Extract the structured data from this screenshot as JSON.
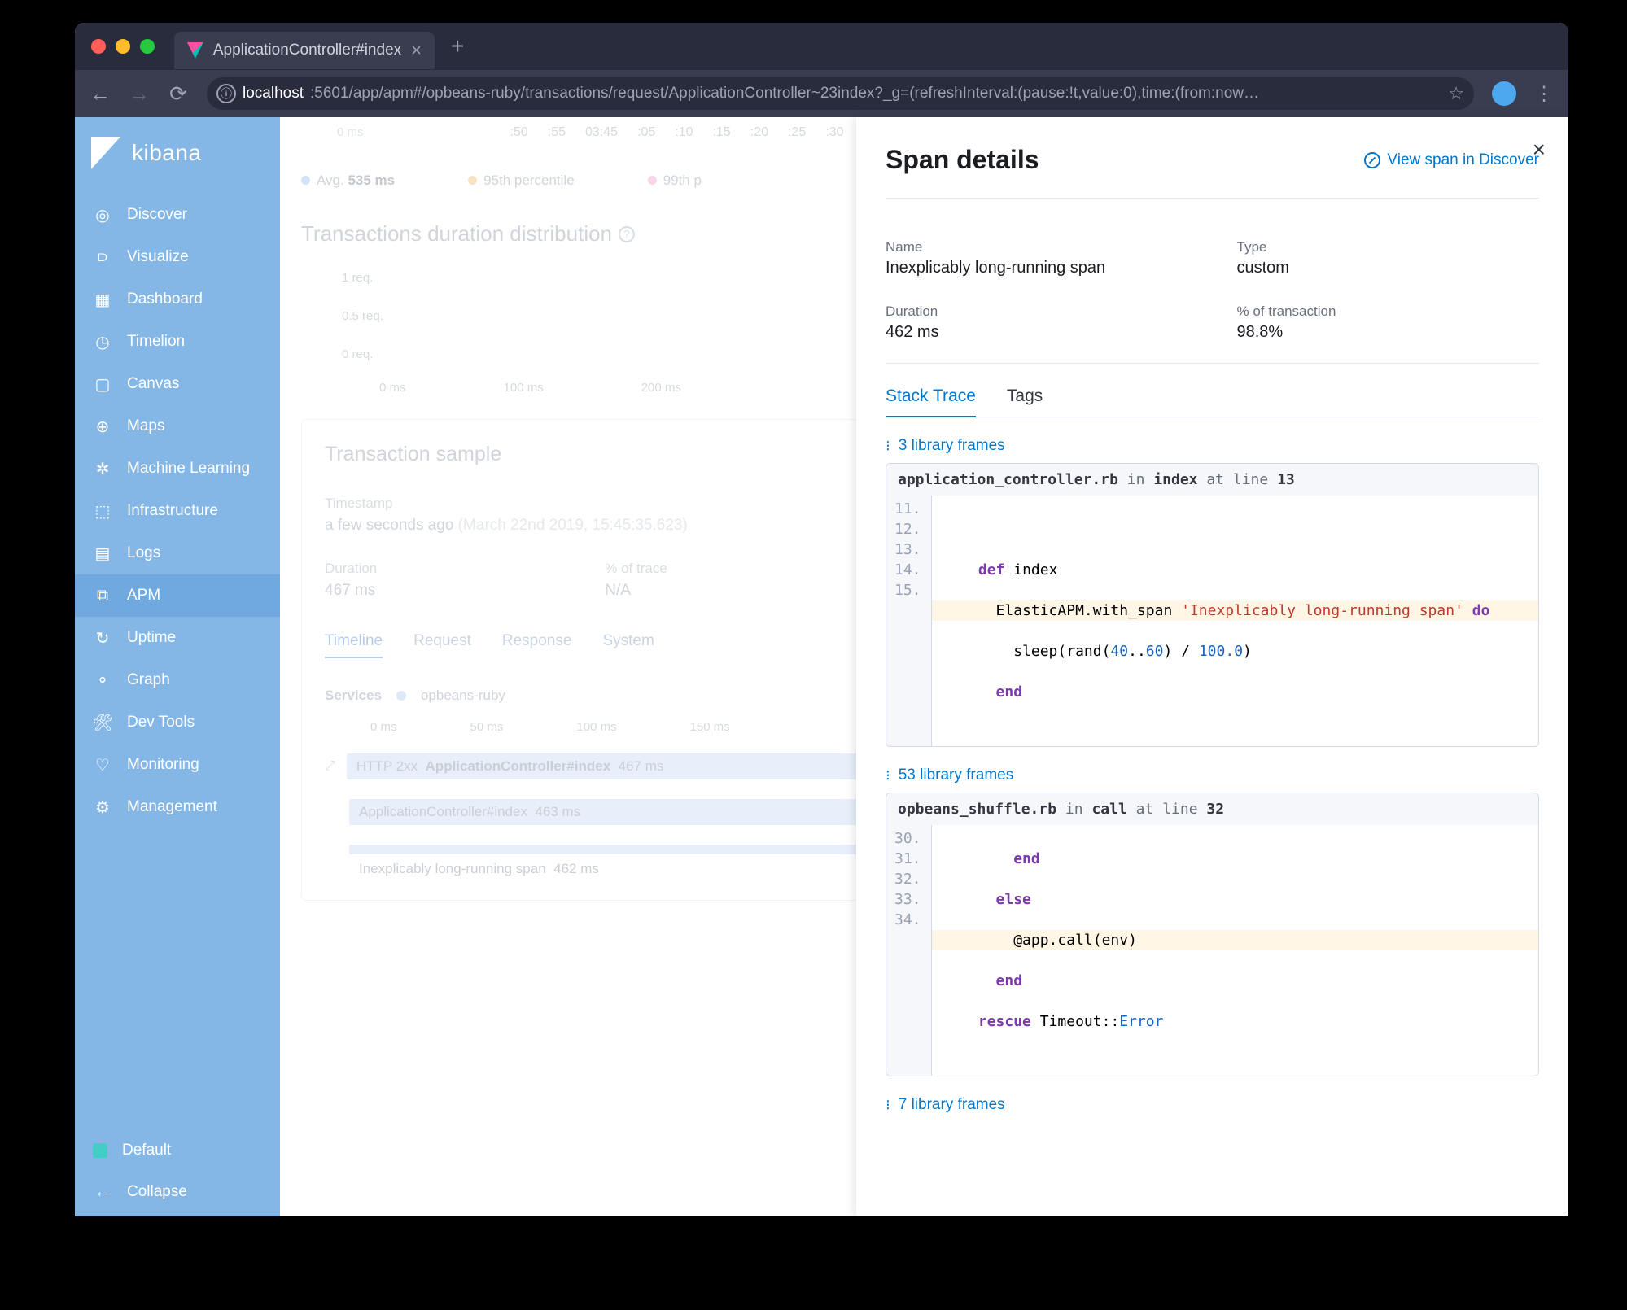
{
  "browser": {
    "tab_title": "ApplicationController#index",
    "url_host": "localhost",
    "url_path": ":5601/app/apm#/opbeans-ruby/transactions/request/ApplicationController~23index?_g=(refreshInterval:(pause:!t,value:0),time:(from:now…"
  },
  "sidebar": {
    "brand": "kibana",
    "items": [
      {
        "label": "Discover",
        "icon": "compass"
      },
      {
        "label": "Visualize",
        "icon": "bar-chart"
      },
      {
        "label": "Dashboard",
        "icon": "grid"
      },
      {
        "label": "Timelion",
        "icon": "clock"
      },
      {
        "label": "Canvas",
        "icon": "square"
      },
      {
        "label": "Maps",
        "icon": "globe"
      },
      {
        "label": "Machine Learning",
        "icon": "ml"
      },
      {
        "label": "Infrastructure",
        "icon": "cube"
      },
      {
        "label": "Logs",
        "icon": "document"
      },
      {
        "label": "APM",
        "icon": "apm",
        "active": true
      },
      {
        "label": "Uptime",
        "icon": "uptime"
      },
      {
        "label": "Graph",
        "icon": "graph"
      },
      {
        "label": "Dev Tools",
        "icon": "wrench"
      },
      {
        "label": "Monitoring",
        "icon": "heartbeat"
      },
      {
        "label": "Management",
        "icon": "gear"
      }
    ],
    "footer": {
      "default": "Default",
      "collapse": "Collapse"
    }
  },
  "background": {
    "chart_y_label": "0 ms",
    "chart_x_ticks": [
      ":50",
      ":55",
      "03:45",
      ":05",
      ":10",
      ":15",
      ":20",
      ":25",
      ":30"
    ],
    "legend_avg": "Avg.",
    "legend_avg_val": "535 ms",
    "legend_95": "95th percentile",
    "legend_99": "99th p",
    "dist_title": "Transactions duration distribution",
    "dist_y_ticks": [
      "1 req.",
      "0.5 req.",
      "0 req."
    ],
    "dist_x_ticks": [
      "0 ms",
      "100 ms",
      "200 ms"
    ],
    "sample_title": "Transaction sample",
    "timestamp_label": "Timestamp",
    "timestamp_val": "a few seconds ago",
    "timestamp_full": "(March 22nd 2019, 15:45:35.623)",
    "duration_label": "Duration",
    "duration_val": "467 ms",
    "trace_label": "% of trace",
    "trace_val": "N/A",
    "tabs": [
      "Timeline",
      "Request",
      "Response",
      "System"
    ],
    "services_label": "Services",
    "service_name": "opbeans-ruby",
    "timeline_ticks": [
      "0 ms",
      "50 ms",
      "100 ms",
      "150 ms"
    ],
    "row1_status": "HTTP 2xx",
    "row1_name": "ApplicationController#index",
    "row1_time": "467 ms",
    "row2_name": "ApplicationController#index",
    "row2_time": "463 ms",
    "row3_name": "Inexplicably long-running span",
    "row3_time": "462 ms"
  },
  "flyout": {
    "title": "Span details",
    "view_link": "View span in Discover",
    "details": {
      "name_label": "Name",
      "name_value": "Inexplicably long-running span",
      "type_label": "Type",
      "type_value": "custom",
      "duration_label": "Duration",
      "duration_value": "462 ms",
      "pct_label": "% of transaction",
      "pct_value": "98.8%"
    },
    "tabs": {
      "stack": "Stack Trace",
      "tags": "Tags"
    },
    "frames": {
      "f1": "3 library frames",
      "f2": "53 library frames",
      "f3": "7 library frames"
    },
    "code1": {
      "file": "application_controller.rb",
      "in": "in",
      "func": "index",
      "at": "at",
      "lineword": "line",
      "line": "13",
      "gutter": [
        "11.",
        "12.",
        "13.",
        "14.",
        "15."
      ]
    },
    "code2": {
      "file": "opbeans_shuffle.rb",
      "in": "in",
      "func": "call",
      "at": "at",
      "lineword": "line",
      "line": "32",
      "gutter": [
        "30.",
        "31.",
        "32.",
        "33.",
        "34."
      ]
    }
  }
}
